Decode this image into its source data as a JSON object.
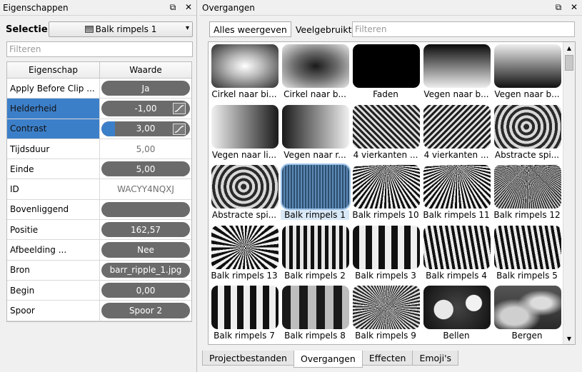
{
  "left_panel": {
    "title": "Eigenschappen",
    "float_icon": "⧉",
    "close_icon": "✕",
    "selection_label": "Selectie:",
    "selection_value": "Balk rimpels 1",
    "filter_placeholder": "Filteren",
    "table": {
      "col_property": "Eigenschap",
      "col_value": "Waarde",
      "rows": [
        {
          "name": "Apply Before Clip ...",
          "value": "Ja",
          "style": "pill",
          "selected": false,
          "fill": 0
        },
        {
          "name": "Helderheid",
          "value": "-1,00",
          "style": "pill-curve",
          "selected": true,
          "fill": 0
        },
        {
          "name": "Contrast",
          "value": "3,00",
          "style": "pill-curve",
          "selected": true,
          "fill": 0.15
        },
        {
          "name": "Tijdsduur",
          "value": "5,00",
          "style": "plain",
          "selected": false,
          "fill": 0
        },
        {
          "name": "Einde",
          "value": "5,00",
          "style": "pill",
          "selected": false,
          "fill": 0
        },
        {
          "name": "ID",
          "value": "WACYY4NQXJ",
          "style": "plain",
          "selected": false,
          "fill": 0
        },
        {
          "name": "Bovenliggend",
          "value": "",
          "style": "pill",
          "selected": false,
          "fill": 0
        },
        {
          "name": "Positie",
          "value": "162,57",
          "style": "pill",
          "selected": false,
          "fill": 0
        },
        {
          "name": "Afbeelding ...",
          "value": "Nee",
          "style": "pill",
          "selected": false,
          "fill": 0
        },
        {
          "name": "Bron",
          "value": "barr_ripple_1.jpg",
          "style": "pill",
          "selected": false,
          "fill": 0
        },
        {
          "name": "Begin",
          "value": "0,00",
          "style": "pill",
          "selected": false,
          "fill": 0
        },
        {
          "name": "Spoor",
          "value": "Spoor 2",
          "style": "pill",
          "selected": false,
          "fill": 0
        }
      ]
    }
  },
  "right_panel": {
    "title": "Overgangen",
    "float_icon": "⧉",
    "close_icon": "✕",
    "tabs": [
      "Alles weergeven",
      "Veelgebruikt"
    ],
    "filter_placeholder": "Filteren",
    "transitions": [
      {
        "label": "Cirkel naar bi...",
        "pattern": "radial-light"
      },
      {
        "label": "Cirkel naar b...",
        "pattern": "radial-dark"
      },
      {
        "label": "Faden",
        "pattern": "black"
      },
      {
        "label": "Vegen naar b...",
        "pattern": "vgrad-down"
      },
      {
        "label": "Vegen naar b...",
        "pattern": "vgrad-up"
      },
      {
        "label": "Vegen naar li...",
        "pattern": "hgrad-left"
      },
      {
        "label": "Vegen naar r...",
        "pattern": "hgrad-right"
      },
      {
        "label": "4 vierkanten ...",
        "pattern": "diag-a"
      },
      {
        "label": "4 vierkanten ...",
        "pattern": "diag-b"
      },
      {
        "label": "Abstracte spi...",
        "pattern": "spiral"
      },
      {
        "label": "Abstracte spi...",
        "pattern": "spiral"
      },
      {
        "label": "Balk rimpels 1",
        "pattern": "blue-ripple",
        "selected": true
      },
      {
        "label": "Balk rimpels 10",
        "pattern": "fan"
      },
      {
        "label": "Balk rimpels 11",
        "pattern": "fan"
      },
      {
        "label": "Balk rimpels 12",
        "pattern": "fan-fine"
      },
      {
        "label": "Balk rimpels 13",
        "pattern": "starburst"
      },
      {
        "label": "Balk rimpels 2",
        "pattern": "vbars"
      },
      {
        "label": "Balk rimpels 3",
        "pattern": "vbars-wide"
      },
      {
        "label": "Balk rimpels 4",
        "pattern": "wavy"
      },
      {
        "label": "Balk rimpels 5",
        "pattern": "wavy"
      },
      {
        "label": "Balk rimpels 7",
        "pattern": "vbars-wide"
      },
      {
        "label": "Balk rimpels 8",
        "pattern": "vbars-soft"
      },
      {
        "label": "Balk rimpels 9",
        "pattern": "starburst-fine"
      },
      {
        "label": "Bellen",
        "pattern": "bubbles"
      },
      {
        "label": "Bergen",
        "pattern": "mountains"
      }
    ]
  },
  "bottom_tabs": {
    "items": [
      "Projectbestanden",
      "Overgangen",
      "Effecten",
      "Emoji's"
    ],
    "active_index": 1
  },
  "icons": {
    "combo_arrow": "▾",
    "scroll_up": "▲",
    "scroll_down": "▼"
  }
}
